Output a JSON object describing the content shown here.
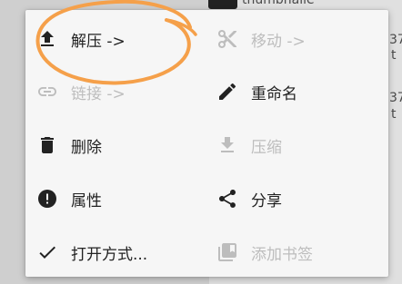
{
  "background": {
    "items": [
      {
        "name": "thumbnail-file-name",
        "text": "thumbnaile"
      },
      {
        "name": "file-meta-1",
        "text": "37"
      },
      {
        "name": "file-meta-2",
        "text": "t"
      },
      {
        "name": "file-meta-3",
        "text": "37"
      },
      {
        "name": "file-meta-4",
        "text": "t"
      }
    ]
  },
  "menu": {
    "extract": {
      "label": "解压 ->",
      "icon": "upload-icon",
      "enabled": true
    },
    "move": {
      "label": "移动 ->",
      "icon": "cut-icon",
      "enabled": false
    },
    "link": {
      "label": "链接 ->",
      "icon": "link-icon",
      "enabled": false
    },
    "rename": {
      "label": "重命名",
      "icon": "pencil-icon",
      "enabled": true
    },
    "delete": {
      "label": "删除",
      "icon": "trash-icon",
      "enabled": true
    },
    "compress": {
      "label": "压缩",
      "icon": "download-icon",
      "enabled": false
    },
    "properties": {
      "label": "属性",
      "icon": "info-icon",
      "enabled": true
    },
    "share": {
      "label": "分享",
      "icon": "share-icon",
      "enabled": true
    },
    "open_with": {
      "label": "打开方式...",
      "icon": "check-icon",
      "enabled": true
    },
    "bookmark": {
      "label": "添加书签",
      "icon": "bookmark-icon",
      "enabled": false
    }
  },
  "colors": {
    "annotation": "#f5a04a",
    "icon_enabled": "#222222",
    "icon_disabled": "#bdbdbd"
  }
}
